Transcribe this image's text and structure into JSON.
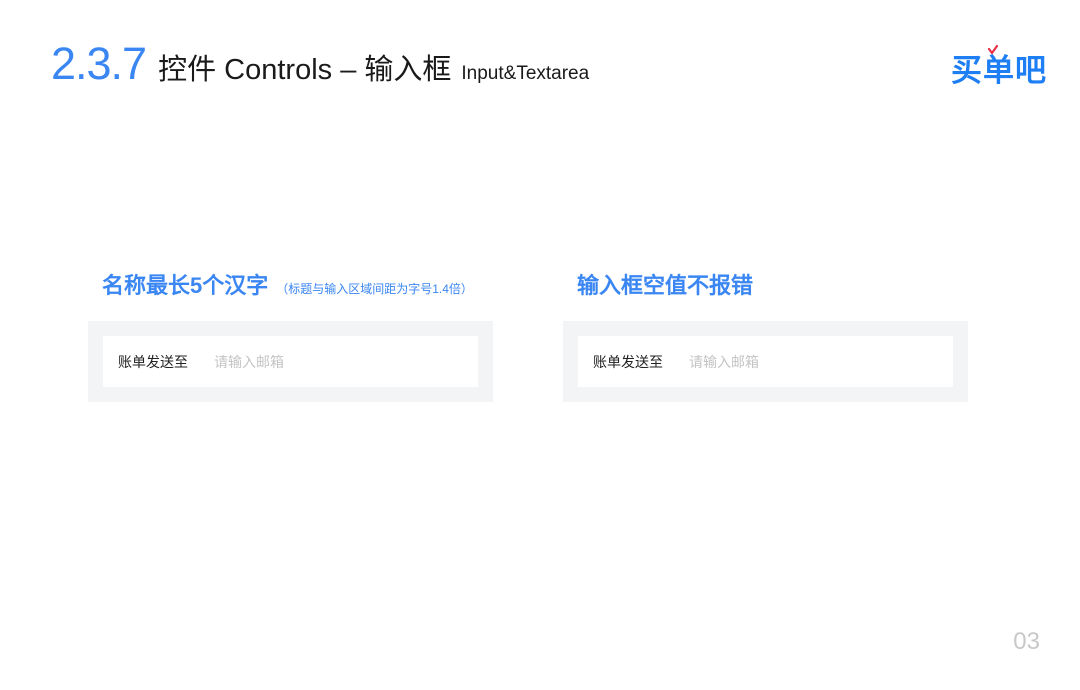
{
  "header": {
    "section_number": "2.3.7",
    "title": "控件 Controls – 输入框",
    "subtitle": "Input&Textarea"
  },
  "brand": {
    "logo_text": "买单吧",
    "logo_color": "#1e7ef4",
    "check_color": "#e8304a"
  },
  "accent_color": "#3a86f2",
  "examples": [
    {
      "label": "名称最长5个汉字",
      "note": "（标题与输入区域间距为字号1.4倍）",
      "field_label": "账单发送至",
      "field_value": "",
      "field_placeholder": "请输入邮箱"
    },
    {
      "label": "输入框空值不报错",
      "note": "",
      "field_label": "账单发送至",
      "field_value": "",
      "field_placeholder": "请输入邮箱"
    }
  ],
  "page_number": "03"
}
